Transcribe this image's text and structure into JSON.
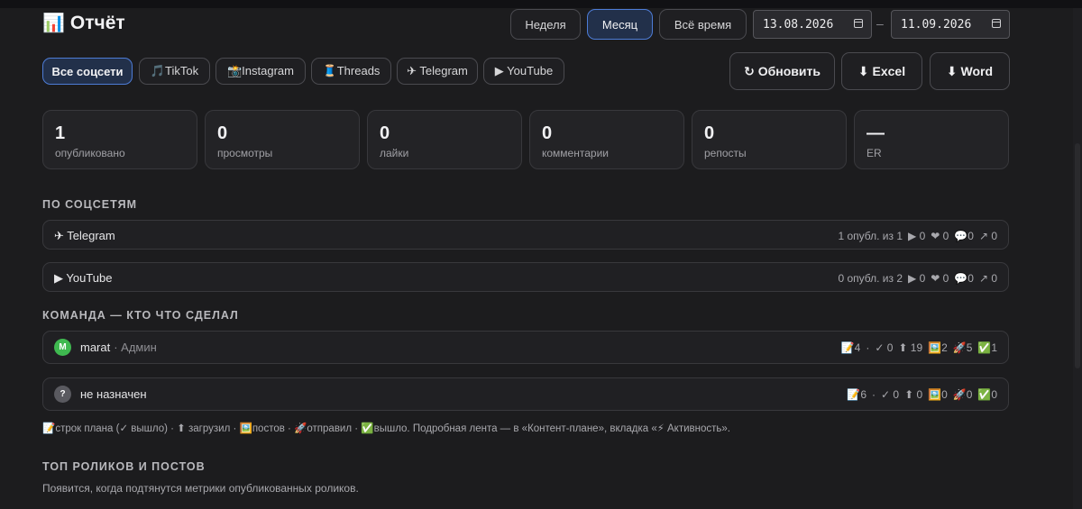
{
  "header": {
    "title_icon": "📊",
    "title": "Отчёт",
    "period_tabs": [
      {
        "label": "Неделя",
        "active": false
      },
      {
        "label": "Месяц",
        "active": true
      },
      {
        "label": "Всё время",
        "active": false
      }
    ],
    "date_from": "13.08.2026",
    "date_to": "11.09.2026",
    "date_separator": "–"
  },
  "filters": [
    {
      "label": "Все соцсети",
      "active": true
    },
    {
      "label": "🎵TikTok",
      "active": false
    },
    {
      "label": "📸Instagram",
      "active": false
    },
    {
      "label": "🧵Threads",
      "active": false
    },
    {
      "label": "✈ Telegram",
      "active": false
    },
    {
      "label": "▶ YouTube",
      "active": false
    }
  ],
  "actions": {
    "refresh": "↻ Обновить",
    "excel": "⬇ Excel",
    "word": "⬇ Word"
  },
  "stats": [
    {
      "value": "1",
      "label": "опубликовано"
    },
    {
      "value": "0",
      "label": "просмотры"
    },
    {
      "value": "0",
      "label": "лайки"
    },
    {
      "value": "0",
      "label": "комментарии"
    },
    {
      "value": "0",
      "label": "репосты"
    },
    {
      "value": "—",
      "label": "ER"
    }
  ],
  "by_network": {
    "title": "ПО СОЦСЕТЯМ",
    "rows": [
      {
        "name": "✈ Telegram",
        "published": "1 опубл. из 1",
        "views": "▶ 0",
        "likes": "❤ 0",
        "comments": "💬0",
        "reposts": "↗ 0"
      },
      {
        "name": "▶ YouTube",
        "published": "0 опубл. из 2",
        "views": "▶ 0",
        "likes": "❤ 0",
        "comments": "💬0",
        "reposts": "↗ 0"
      }
    ]
  },
  "team": {
    "title": "КОМАНДА — КТО ЧТО СДЕЛАЛ",
    "rows": [
      {
        "avatar": "M",
        "avatar_color": "#3fb950",
        "name": "marat",
        "role": " · Админ",
        "plan": "📝4",
        "done": "✓ 0",
        "uploaded": "⬆ 19",
        "posts": "🖼️2",
        "sent": "🚀5",
        "out": "✅1"
      },
      {
        "avatar": "?",
        "avatar_color": "#5a5a60",
        "name": "не назначен",
        "role": "",
        "plan": "📝6",
        "done": "✓ 0",
        "uploaded": "⬆ 0",
        "posts": "🖼️0",
        "sent": "🚀0",
        "out": "✅0"
      }
    ],
    "legend": "📝строк плана (✓ вышло) · ⬆ загрузил · 🖼️постов · 🚀отправил · ✅вышло. Подробная лента — в «Контент-плане», вкладка «⚡ Активность»."
  },
  "top": {
    "title": "ТОП РОЛИКОВ И ПОСТОВ",
    "note": "Появится, когда подтянутся метрики опубликованных роликов."
  }
}
